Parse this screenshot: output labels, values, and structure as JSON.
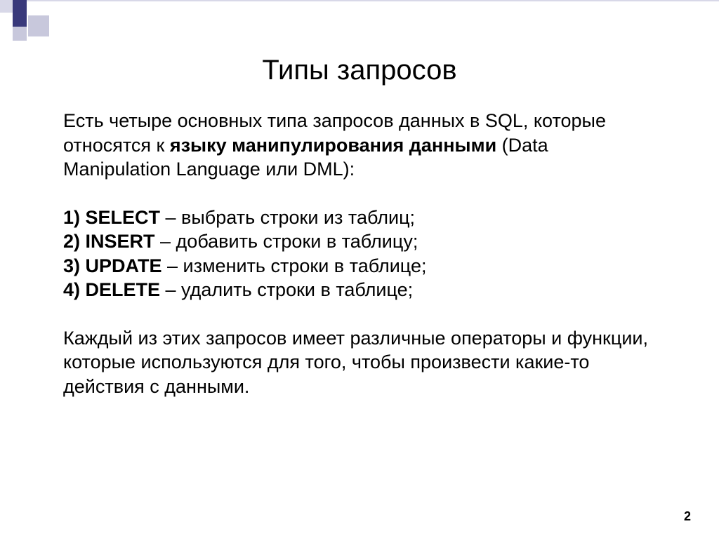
{
  "title": "Типы запросов",
  "intro": {
    "part1": "Есть четыре основных типа запросов данных в SQL, которые относятся к ",
    "bold": "языку манипулирования данными",
    "part2": " (Data Manipulation Language или DML):"
  },
  "items": [
    {
      "num": "1) SELECT",
      "desc": " – выбрать строки из таблиц;"
    },
    {
      "num": "2) INSERT",
      "desc": " – добавить строки в таблицу;"
    },
    {
      "num": "3) UPDATE",
      "desc": " – изменить строки в таблице;"
    },
    {
      "num": "4) DELETE",
      "desc": " – удалить строки в таблице;"
    }
  ],
  "outro": "Каждый из этих запросов имеет различные операторы и функции, которые используются для того, чтобы произвести какие-то действия с данными.",
  "pageNumber": "2"
}
